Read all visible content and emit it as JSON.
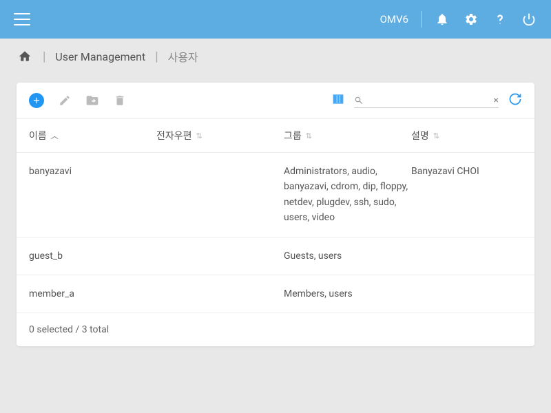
{
  "topbar": {
    "brand": "OMV6"
  },
  "breadcrumb": {
    "items": [
      {
        "label": "User Management"
      },
      {
        "label": "사용자"
      }
    ]
  },
  "table": {
    "columns": {
      "name": "이름",
      "email": "전자우편",
      "groups": "그룹",
      "description": "설명"
    },
    "rows": [
      {
        "name": "banyazavi",
        "email": "",
        "groups": "Administrators, audio, banyazavi, cdrom, dip, floppy, netdev, plugdev, ssh, sudo, users, video",
        "description": "Banyazavi CHOI"
      },
      {
        "name": "guest_b",
        "email": "",
        "groups": "Guests, users",
        "description": ""
      },
      {
        "name": "member_a",
        "email": "",
        "groups": "Members, users",
        "description": ""
      }
    ],
    "footer": "0 selected / 3 total"
  }
}
